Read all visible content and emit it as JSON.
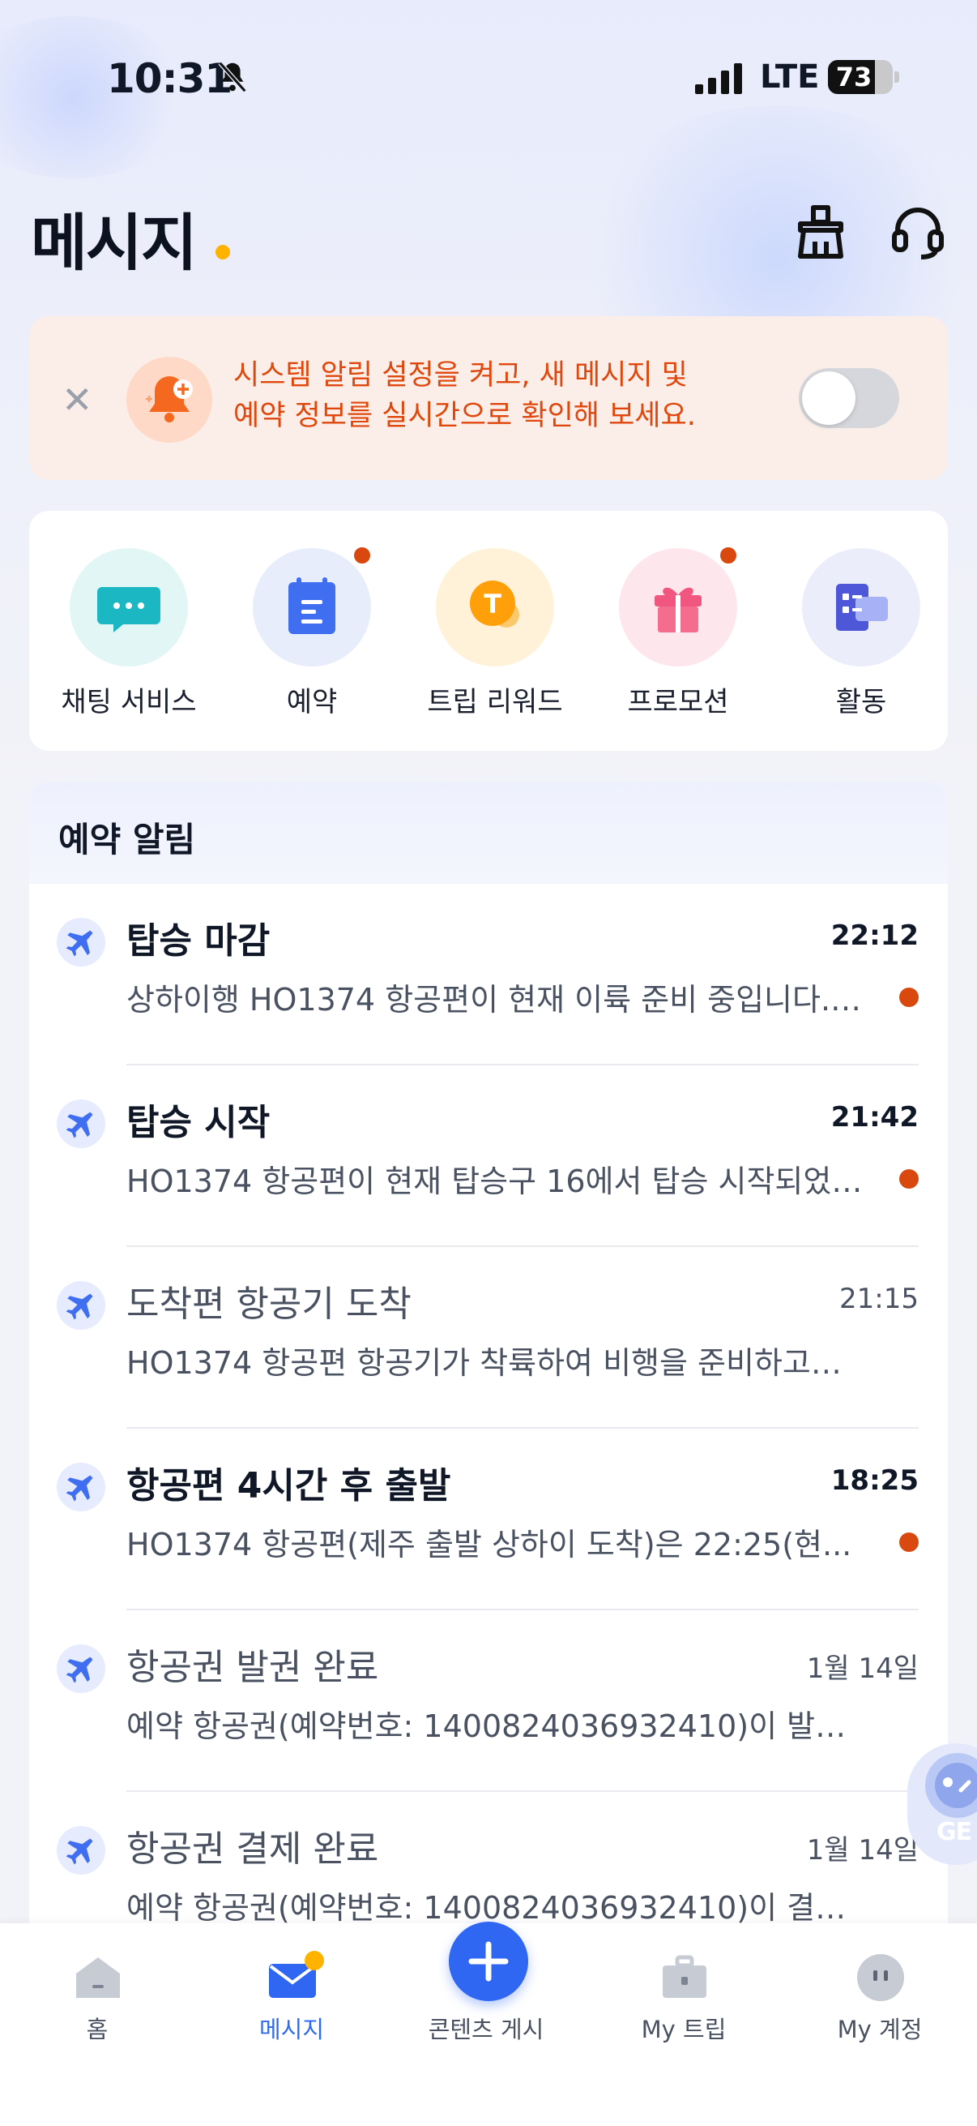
{
  "status_bar": {
    "time": "10:31",
    "network": "LTE",
    "battery": "73",
    "battery_level": 0.73
  },
  "header": {
    "title": "메시지"
  },
  "banner": {
    "text_line1": "시스템 알림 설정을 켜고, 새 메시지 및",
    "text_line2": "예약 정보를 실시간으로 확인해 보세요.",
    "toggle_on": false
  },
  "shortcuts": [
    {
      "label": "채팅 서비스",
      "icon": "chat-bubble-icon",
      "badge": false,
      "bg": "#e3f6f6"
    },
    {
      "label": "예약",
      "icon": "calendar-icon",
      "badge": true,
      "bg": "#e8edfc"
    },
    {
      "label": "트립 리워드",
      "icon": "trip-coin-icon",
      "badge": false,
      "bg": "#fff2d8"
    },
    {
      "label": "프로모션",
      "icon": "gift-icon",
      "badge": true,
      "bg": "#fde7ec"
    },
    {
      "label": "활동",
      "icon": "activity-icon",
      "badge": false,
      "bg": "#ebedfb"
    }
  ],
  "booking_alerts": {
    "title": "예약 알림",
    "items": [
      {
        "title": "탑승 마감",
        "time": "22:12",
        "subtitle": "상하이행 HO1374 항공편이 현재 이륙 준비 중입니다.…",
        "unread": true
      },
      {
        "title": "탑승 시작",
        "time": "21:42",
        "subtitle": "HO1374 항공편이 현재 탑승구 16에서 탑승 시작되었…",
        "unread": true
      },
      {
        "title": "도착편 항공기 도착",
        "time": "21:15",
        "subtitle": "HO1374 항공편 항공기가 착륙하여 비행을 준비하고…",
        "unread": false
      },
      {
        "title": "항공편 4시간 후 출발",
        "time": "18:25",
        "subtitle": "HO1374 항공편(제주 출발 상하이 도착)은 22:25(현...",
        "unread": true
      },
      {
        "title": "항공권 발권 완료",
        "time": "1월 14일",
        "subtitle": "예약 항공권(예약번호: 1400824036932410)이 발…",
        "unread": false
      },
      {
        "title": "항공권 결제 완료",
        "time": "1월 14일",
        "subtitle": "예약 항공권(예약번호: 1400824036932410)이 결…",
        "unread": false
      }
    ]
  },
  "floating_bot": {
    "label": "GE"
  },
  "tabbar": {
    "home": "홈",
    "messages": "메시지",
    "post": "콘텐츠 게시",
    "my_trip": "My 트립",
    "my_account": "My 계정"
  },
  "colors": {
    "accent": "#2f66f2",
    "unread_dot": "#d9480f",
    "banner_text": "#e0470c",
    "title_dot": "#ffb300"
  }
}
